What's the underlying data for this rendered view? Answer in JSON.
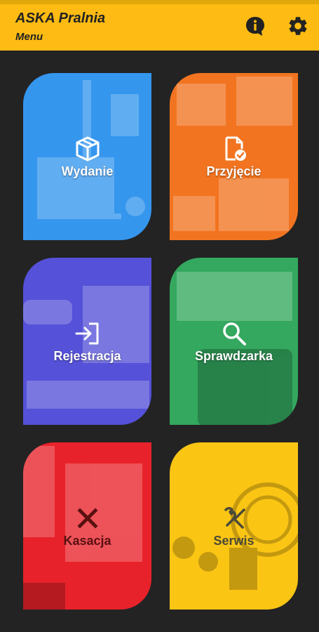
{
  "app": {
    "title": "ASKA Pralnia",
    "subtitle": "Menu",
    "accent_color": "#fdbb13"
  },
  "toolbar": {
    "info_icon": "info-bubble-icon",
    "settings_icon": "gear-icon"
  },
  "tiles": [
    {
      "label": "Wydanie",
      "icon": "box-icon",
      "color": "#3596ee"
    },
    {
      "label": "Przyjęcie",
      "icon": "document-check-icon",
      "color": "#f27420"
    },
    {
      "label": "Rejestracja",
      "icon": "sign-in-icon",
      "color": "#5551d8"
    },
    {
      "label": "Sprawdzarka",
      "icon": "magnifier-icon",
      "color": "#33a85e"
    },
    {
      "label": "Kasacja",
      "icon": "close-x-icon",
      "color": "#e8222a"
    },
    {
      "label": "Serwis",
      "icon": "wrench-screwdriver-icon",
      "color": "#fbc514"
    }
  ]
}
